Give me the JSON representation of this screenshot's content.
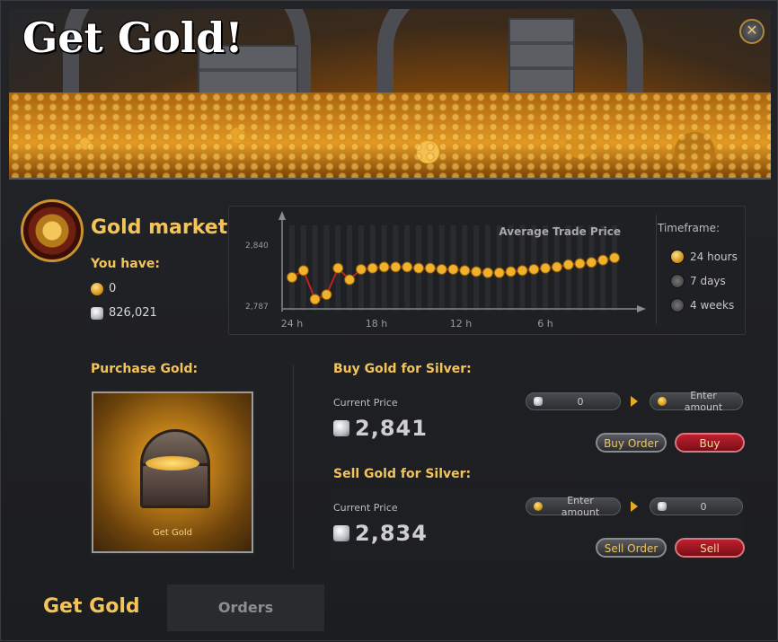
{
  "title": "Get Gold!",
  "close_icon": "close-icon",
  "market": {
    "title": "Gold market",
    "you_have_label": "You have:",
    "gold_amount": "0",
    "silver_amount": "826,021"
  },
  "chart": {
    "title": "Average Trade Price",
    "y_max_label": "2,840",
    "y_min_label": "2,787",
    "x_labels": [
      "24 h",
      "18 h",
      "12 h",
      "6 h"
    ]
  },
  "chart_data": {
    "type": "line",
    "title": "Average Trade Price",
    "xlabel": "",
    "ylabel": "",
    "x_ticks": [
      "24 h",
      "18 h",
      "12 h",
      "6 h"
    ],
    "ylim": [
      2787,
      2840
    ],
    "y_ticks": [
      2787,
      2840
    ],
    "grid": true,
    "series": [
      {
        "values": [
          2812,
          2818,
          2793,
          2797,
          2820,
          2810,
          2819,
          2820,
          2821,
          2821,
          2821,
          2820,
          2820,
          2819,
          2819,
          2818,
          2817,
          2816,
          2816,
          2817,
          2818,
          2819,
          2820,
          2821,
          2823,
          2824,
          2825,
          2827,
          2829
        ]
      }
    ]
  },
  "timeframe": {
    "label": "Timeframe:",
    "options": [
      "24 hours",
      "7 days",
      "4 weeks"
    ],
    "selected": "24 hours"
  },
  "purchase": {
    "label": "Purchase Gold:",
    "chest_label": "Get Gold"
  },
  "buy": {
    "title": "Buy Gold for Silver:",
    "current_price_label": "Current Price",
    "price": "2,841",
    "silver_value": "0",
    "amount_placeholder": "Enter amount",
    "order_button": "Buy Order",
    "action_button": "Buy"
  },
  "sell": {
    "title": "Sell Gold for Silver:",
    "current_price_label": "Current Price",
    "price": "2,834",
    "amount_placeholder": "Enter amount",
    "silver_value": "0",
    "order_button": "Sell Order",
    "action_button": "Sell"
  },
  "tabs": {
    "active": "Get Gold",
    "other": "Orders"
  },
  "colors": {
    "gold_text": "#f2c45a",
    "background": "#1f2023",
    "buy_red": "#c0202e",
    "chart_line": "#c0221e",
    "chart_marker": "#f0b12c"
  }
}
